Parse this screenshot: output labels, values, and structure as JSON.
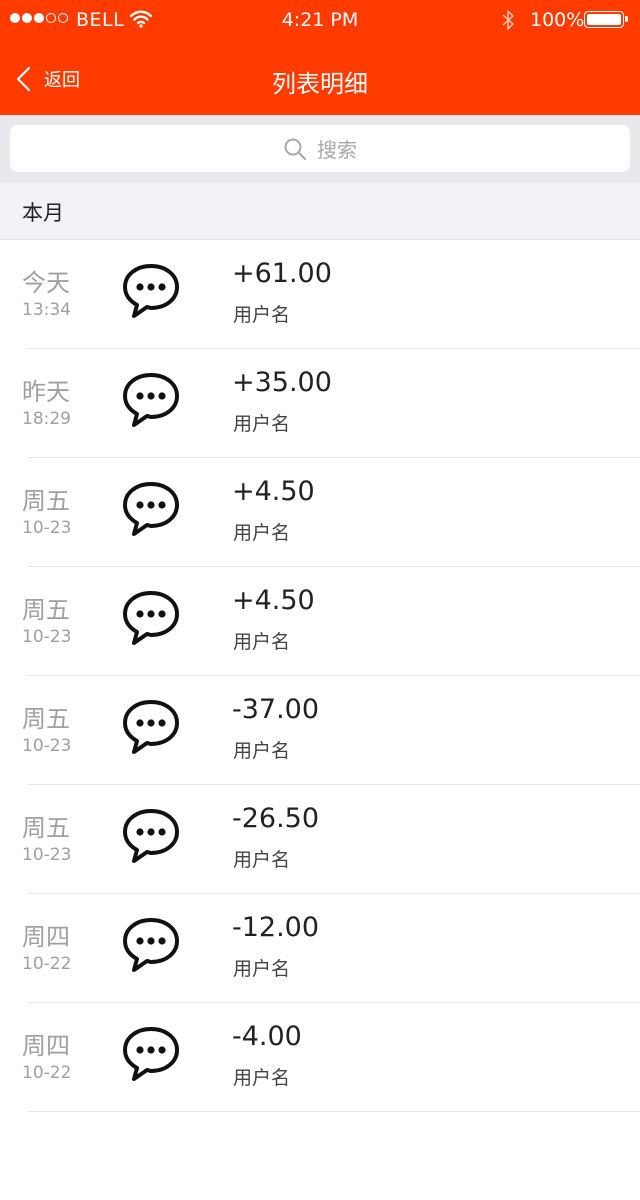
{
  "status_bar": {
    "carrier": "BELL",
    "time": "4:21 PM",
    "battery": "100%"
  },
  "nav": {
    "back_label": "返回",
    "title": "列表明细"
  },
  "search": {
    "placeholder": "搜索"
  },
  "section": {
    "title": "本月"
  },
  "rows": [
    {
      "day": "今天",
      "date": "13:34",
      "amount": "+61.00",
      "username": "用户名"
    },
    {
      "day": "昨天",
      "date": "18:29",
      "amount": "+35.00",
      "username": "用户名"
    },
    {
      "day": "周五",
      "date": "10-23",
      "amount": "+4.50",
      "username": "用户名"
    },
    {
      "day": "周五",
      "date": "10-23",
      "amount": "+4.50",
      "username": "用户名"
    },
    {
      "day": "周五",
      "date": "10-23",
      "amount": "-37.00",
      "username": "用户名"
    },
    {
      "day": "周五",
      "date": "10-23",
      "amount": "-26.50",
      "username": "用户名"
    },
    {
      "day": "周四",
      "date": "10-22",
      "amount": "-12.00",
      "username": "用户名"
    },
    {
      "day": "周四",
      "date": "10-22",
      "amount": "-4.00",
      "username": "用户名"
    }
  ],
  "colors": {
    "header_bg": "#ff3b00",
    "search_bg": "#e8e8ed",
    "section_bg": "#f3f3f7"
  },
  "icons": {
    "row_icon": "chat-bubble-icon",
    "search_icon": "search-icon",
    "back_icon": "chevron-left-icon"
  }
}
